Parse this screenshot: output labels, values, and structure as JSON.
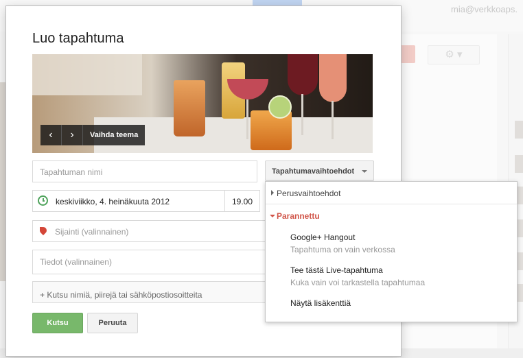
{
  "background": {
    "user_email": "mia@verkkoaps."
  },
  "dialog": {
    "title": "Luo tapahtuma",
    "theme_nav": {
      "prev": "‹",
      "next": "›",
      "change_theme": "Vaihda teema"
    },
    "event_name_placeholder": "Tapahtuman nimi",
    "date": "keskiviikko, 4. heinäkuuta 2012",
    "time": "19.00",
    "location_placeholder": "Sijainti (valinnainen)",
    "details_placeholder": "Tiedot (valinnainen)",
    "invite_placeholder": "+ Kutsu nimiä, piirejä tai sähköpostiosoitteita",
    "invite_button": "Kutsu",
    "cancel_button": "Peruuta",
    "options_button": "Tapahtumavaihtoehdot"
  },
  "menu": {
    "basic_options": "Perusvaihtoehdot",
    "advanced_section": "Parannettu",
    "items": [
      {
        "title": "Google+ Hangout",
        "subtitle": "Tapahtuma on vain verkossa"
      },
      {
        "title": "Tee tästä Live-tapahtuma",
        "subtitle": "Kuka vain voi tarkastella tapahtumaa"
      },
      {
        "title": "Näytä lisäkenttiä",
        "subtitle": ""
      }
    ]
  },
  "colors": {
    "accent_green": "#78b86b",
    "section_red": "#d1564a",
    "clock_green": "#4fa35c",
    "pin_red": "#d44638"
  }
}
